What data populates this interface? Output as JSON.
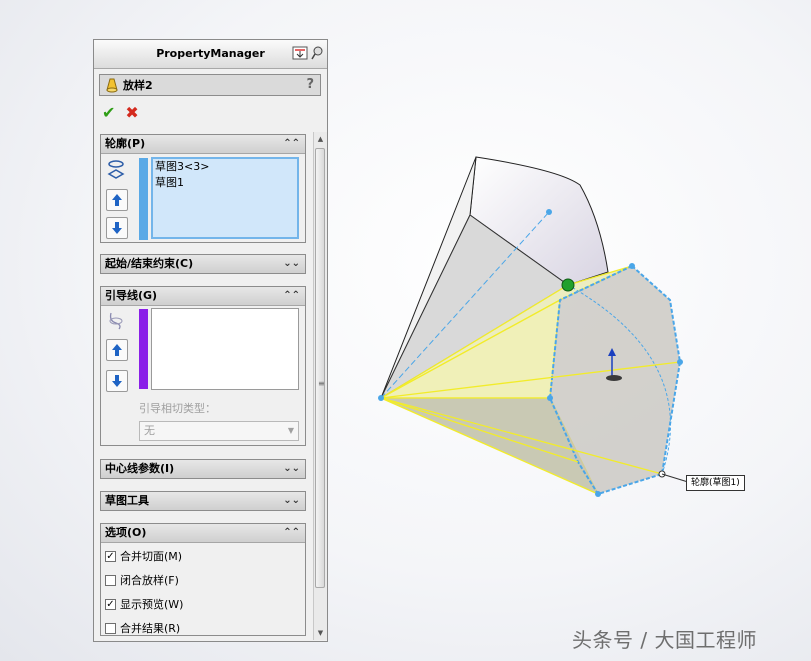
{
  "panel": {
    "title": "PropertyManager",
    "feature_name": "放样2",
    "help_label": "?",
    "ok_label": "✔",
    "cancel_label": "✖"
  },
  "groups": {
    "profiles": {
      "title": "轮廓(P)",
      "items": [
        "草图3<3>",
        "草图1"
      ],
      "accent": "#5aa9e6"
    },
    "start_end": {
      "title": "起始/结束约束(C)"
    },
    "guides": {
      "title": "引导线(G)",
      "accent": "#8a1fe8",
      "tangency_label": "引导相切类型：",
      "tangency_value": "无"
    },
    "centerline": {
      "title": "中心线参数(I)"
    },
    "sketch_tools": {
      "title": "草图工具"
    },
    "options": {
      "title": "选项(O)",
      "items": [
        {
          "label": "合并切面(M)",
          "checked": true
        },
        {
          "label": "闭合放样(F)",
          "checked": false
        },
        {
          "label": "显示预览(W)",
          "checked": true
        },
        {
          "label": "合并结果(R)",
          "checked": false
        }
      ]
    }
  },
  "viewport": {
    "callout": "轮廓(草图1)",
    "colors": {
      "preview_fill": "#ecedc0",
      "edge": "#f2ec2a",
      "profile": "#4aa6e8",
      "point": "#21a02c"
    }
  },
  "watermark": "头条号 / 大国工程师"
}
